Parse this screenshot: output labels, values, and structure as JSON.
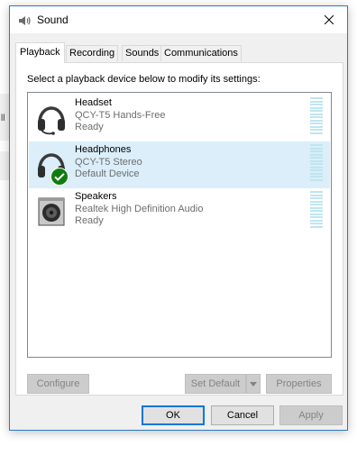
{
  "window": {
    "title": "Sound",
    "title_icon": "speaker-icon",
    "close_icon": "close-icon"
  },
  "background": {
    "glyph": "ll"
  },
  "tabs": [
    {
      "label": "Playback",
      "active": true
    },
    {
      "label": "Recording",
      "active": false
    },
    {
      "label": "Sounds",
      "active": false
    },
    {
      "label": "Communications",
      "active": false
    }
  ],
  "playback": {
    "instruction": "Select a playback device below to modify its settings:",
    "devices": [
      {
        "name": "Headset",
        "model": "QCY-T5 Hands-Free",
        "status": "Ready",
        "icon": "headset-icon",
        "selected": false
      },
      {
        "name": "Headphones",
        "model": "QCY-T5 Stereo",
        "status": "Default Device",
        "icon": "headphones-icon",
        "selected": true,
        "badge": "default-check-icon"
      },
      {
        "name": "Speakers",
        "model": "Realtek High Definition Audio",
        "status": "Ready",
        "icon": "speaker-box-icon",
        "selected": false
      }
    ],
    "buttons": {
      "configure": "Configure",
      "set_default": "Set Default",
      "properties": "Properties"
    }
  },
  "footer": {
    "ok": "OK",
    "cancel": "Cancel",
    "apply": "Apply"
  },
  "colors": {
    "accent": "#0078d7",
    "selected_row": "#dbeefa",
    "check_green": "#107c10",
    "meter": "#bfe5f0"
  }
}
